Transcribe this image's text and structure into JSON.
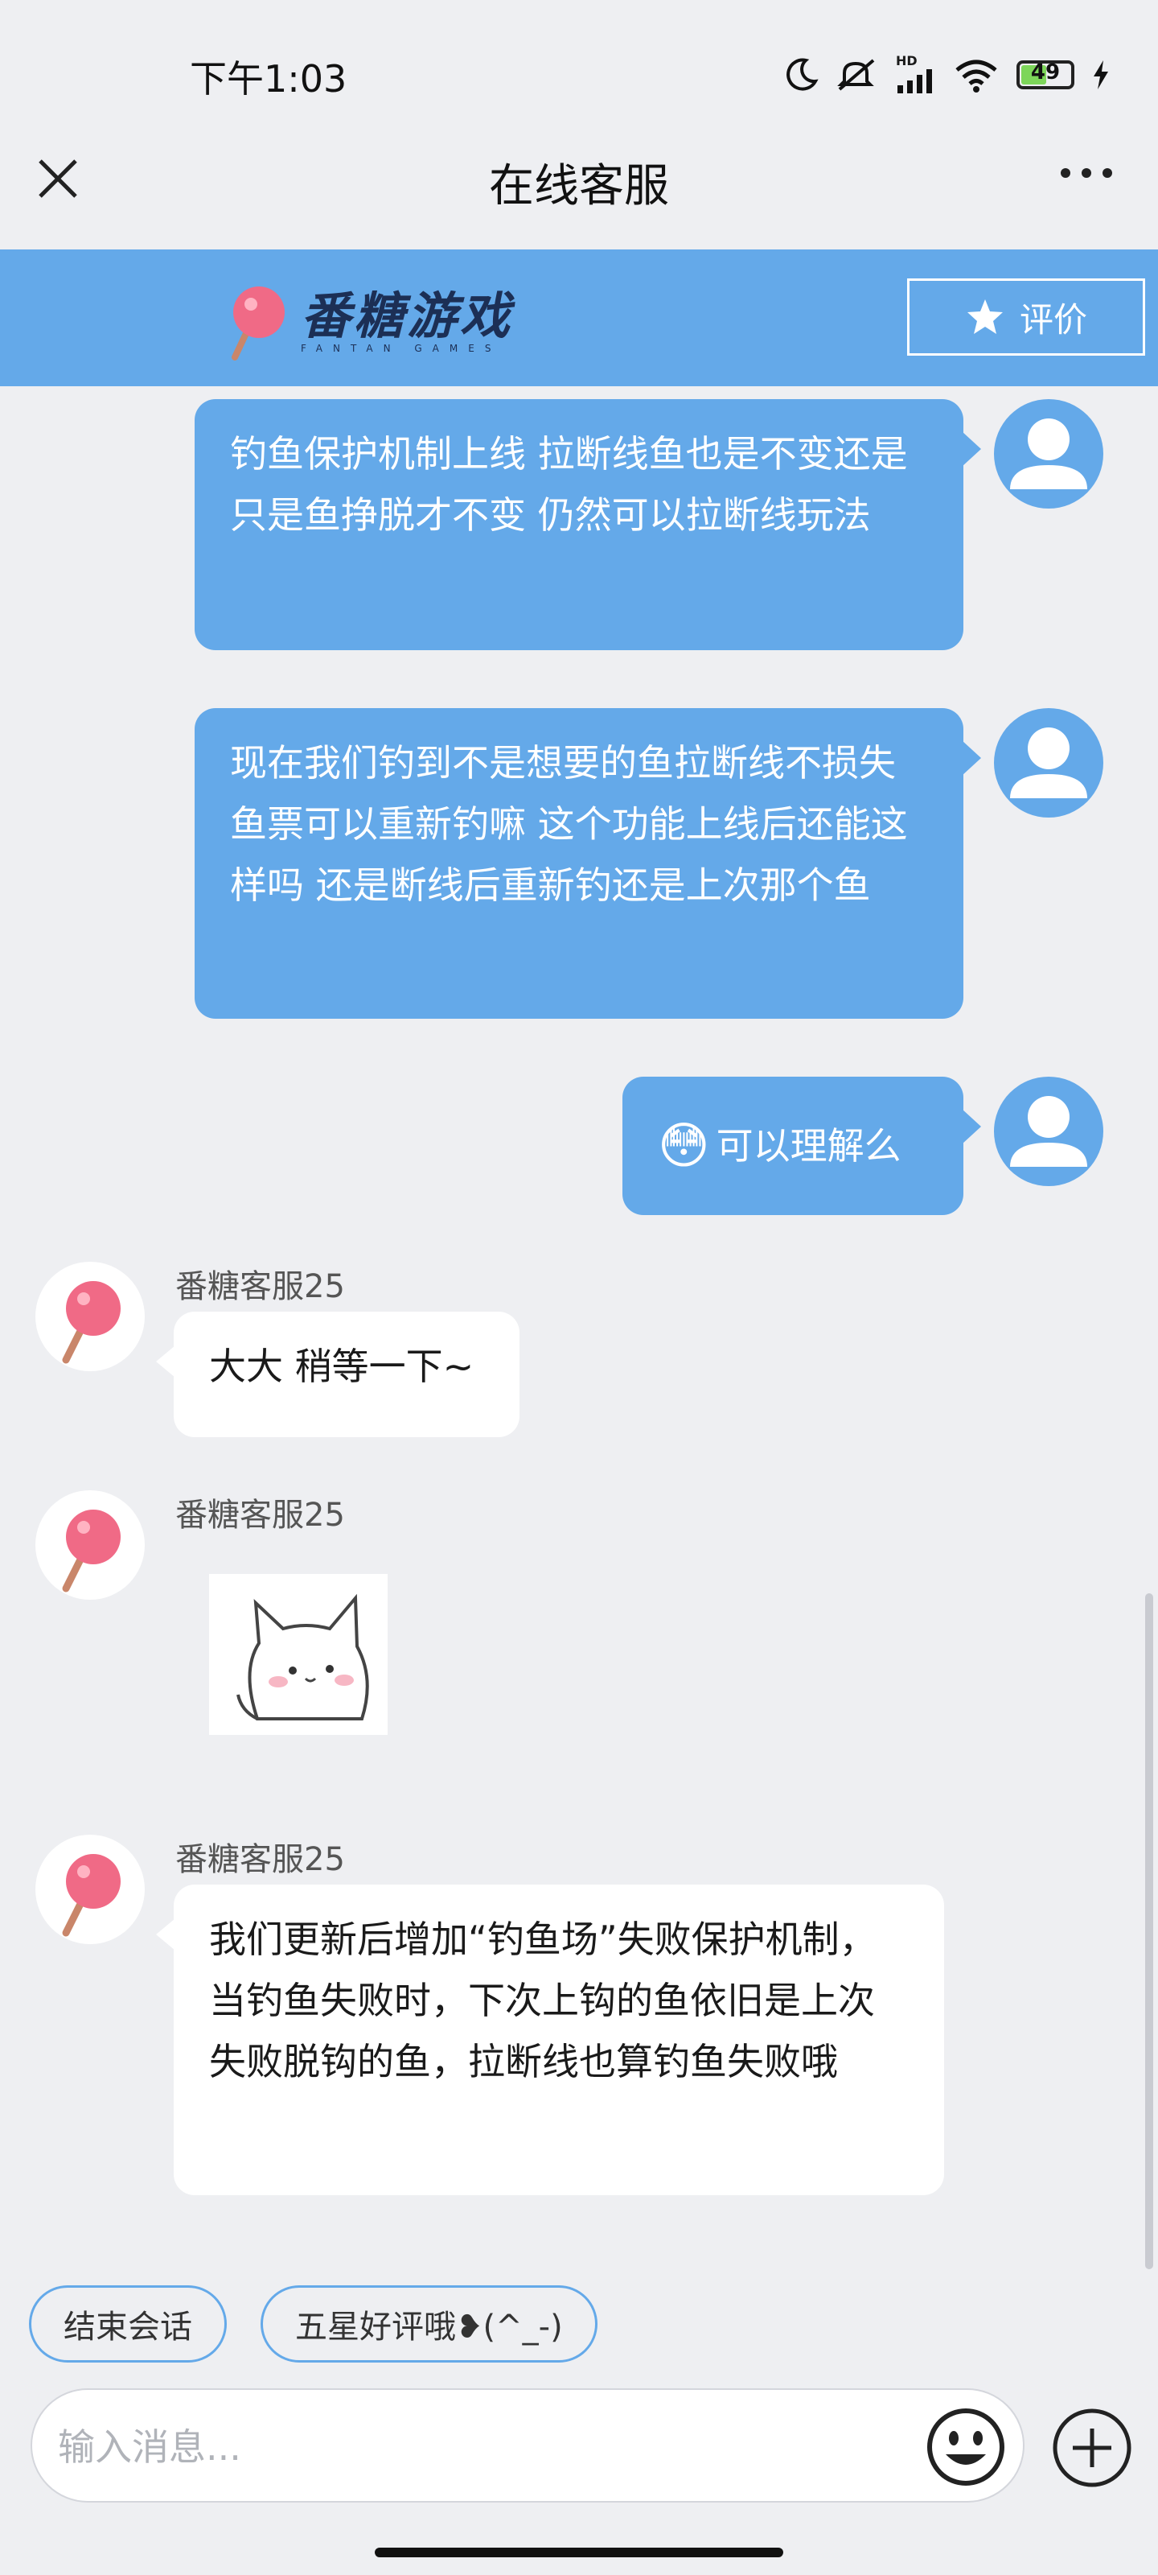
{
  "status_bar": {
    "time": "下午1:03",
    "battery_level": "49",
    "network": "HD"
  },
  "navbar": {
    "title": "在线客服"
  },
  "brand": {
    "name": "番糖游戏",
    "sub": "FANTAN GAMES",
    "rate_label": "评价"
  },
  "messages": [
    {
      "side": "out",
      "text": "钓鱼保护机制上线  拉断线鱼也是不变还是 只是鱼挣脱才不变 仍然可以拉断线玩法"
    },
    {
      "side": "out",
      "text": "现在我们钓到不是想要的鱼拉断线不损失鱼票可以重新钓嘛  这个功能上线后还能这样吗 还是断线后重新钓还是上次那个鱼"
    },
    {
      "side": "out",
      "emoji": "😳",
      "text": "可以理解么"
    },
    {
      "side": "in",
      "sender": "番糖客服25",
      "text": "大大 稍等一下~"
    },
    {
      "side": "in",
      "sender": "番糖客服25",
      "sticker": "cat-sticker"
    },
    {
      "side": "in",
      "sender": "番糖客服25",
      "text": "我们更新后增加“钓鱼场”失败保护机制，当钓鱼失败时，下次上钩的鱼依旧是上次失败脱钩的鱼，拉断线也算钓鱼失败哦"
    }
  ],
  "quick_replies": [
    "结束会话",
    "五星好评哦❥(^_-)"
  ],
  "input": {
    "placeholder": "输入消息..."
  },
  "colors": {
    "accent": "#64a9e9",
    "background": "#eeeff2",
    "brand_text": "#1c2f55",
    "candy": "#f06a86"
  },
  "icons": [
    "close-icon",
    "more-icon",
    "star-icon",
    "user-avatar-icon",
    "candy-avatar-icon",
    "emoji-icon",
    "plus-icon",
    "moon-icon",
    "mute-icon",
    "signal-icon",
    "wifi-icon",
    "battery-icon",
    "charging-icon"
  ]
}
